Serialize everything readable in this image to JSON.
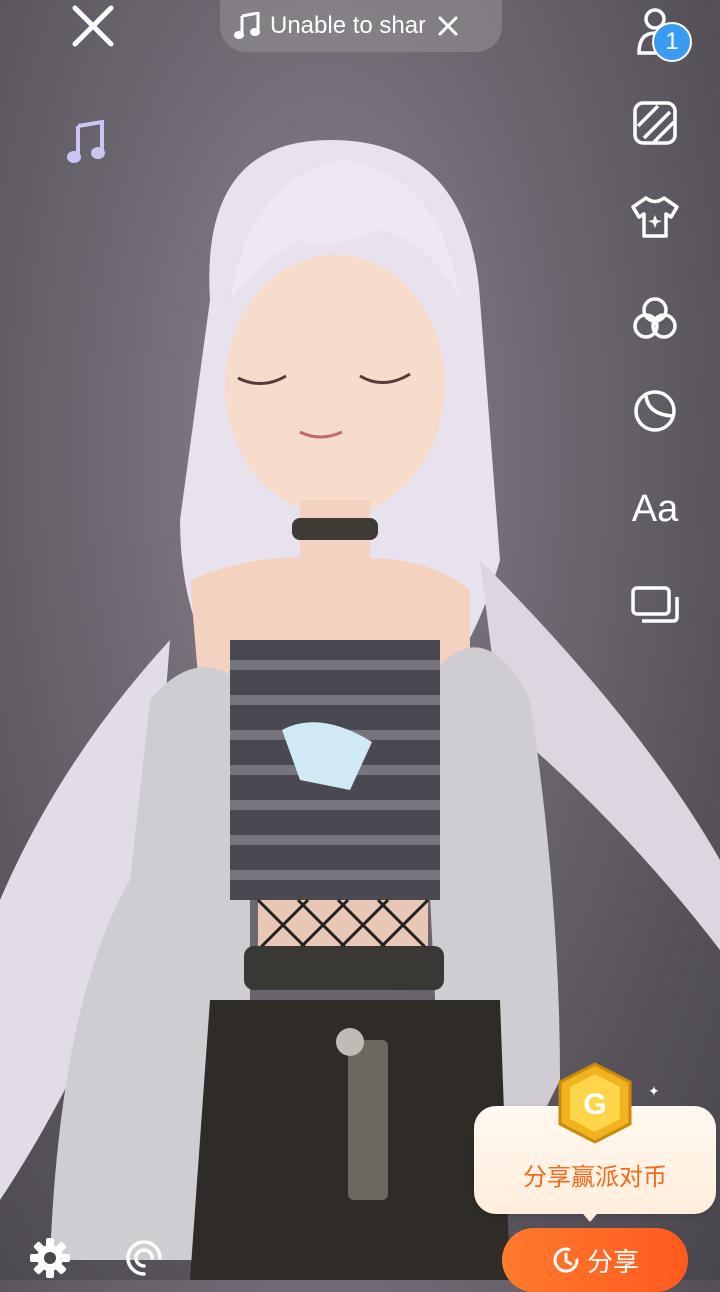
{
  "top": {
    "music_status": "Unable to share"
  },
  "toolbar": {
    "badge_count": "1",
    "text_tool_label": "Aa"
  },
  "promo": {
    "label": "分享赢派对币"
  },
  "share": {
    "label": "分享"
  },
  "icons": {
    "close": "close-icon",
    "music": "music-note-icon",
    "avatar": "person-icon",
    "background": "striped-square-icon",
    "outfit": "tshirt-icon",
    "filter": "circles-icon",
    "moon": "moon-icon",
    "layout": "layers-icon",
    "settings": "gear-icon",
    "rotate": "swirl-icon",
    "coin": "coin-icon"
  },
  "colors": {
    "accent_orange": "#ff6a24",
    "badge_blue": "#3a9cf0",
    "promo_text": "#f06a1a"
  }
}
